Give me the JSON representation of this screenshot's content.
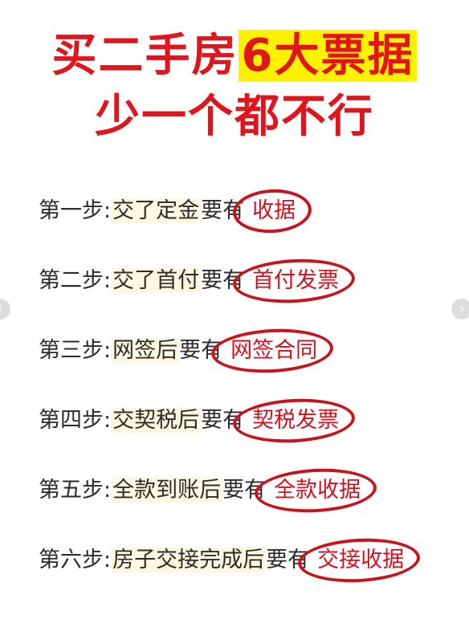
{
  "title": {
    "line1_prefix": "买二手房",
    "line1_highlight": "6大票据",
    "line2": "少一个都不行"
  },
  "steps": [
    {
      "label": "第一步:",
      "action": "交了定金",
      "need": "要有",
      "doc": "收据"
    },
    {
      "label": "第二步:",
      "action": "交了首付",
      "need": "要有",
      "doc": "首付发票"
    },
    {
      "label": "第三步:",
      "action": "网签后",
      "need": "要有",
      "doc": "网签合同"
    },
    {
      "label": "第四步:",
      "action": "交契税后",
      "need": "要有",
      "doc": "契税发票"
    },
    {
      "label": "第五步:",
      "action": "全款到账后",
      "need": "要有",
      "doc": "全款收据"
    },
    {
      "label": "第六步:",
      "action": "房子交接完成后",
      "need": "要有",
      "doc": "交接收据"
    }
  ],
  "nav": {
    "prev_icon": "chevron-left-icon",
    "next_icon": "chevron-right-icon",
    "prev_glyph": "‹",
    "next_glyph": "›"
  },
  "colors": {
    "title_red": "#e0161d",
    "highlight_yellow": "#fff200",
    "circle_red": "#c6151d",
    "action_bg": "#fdf8df"
  }
}
